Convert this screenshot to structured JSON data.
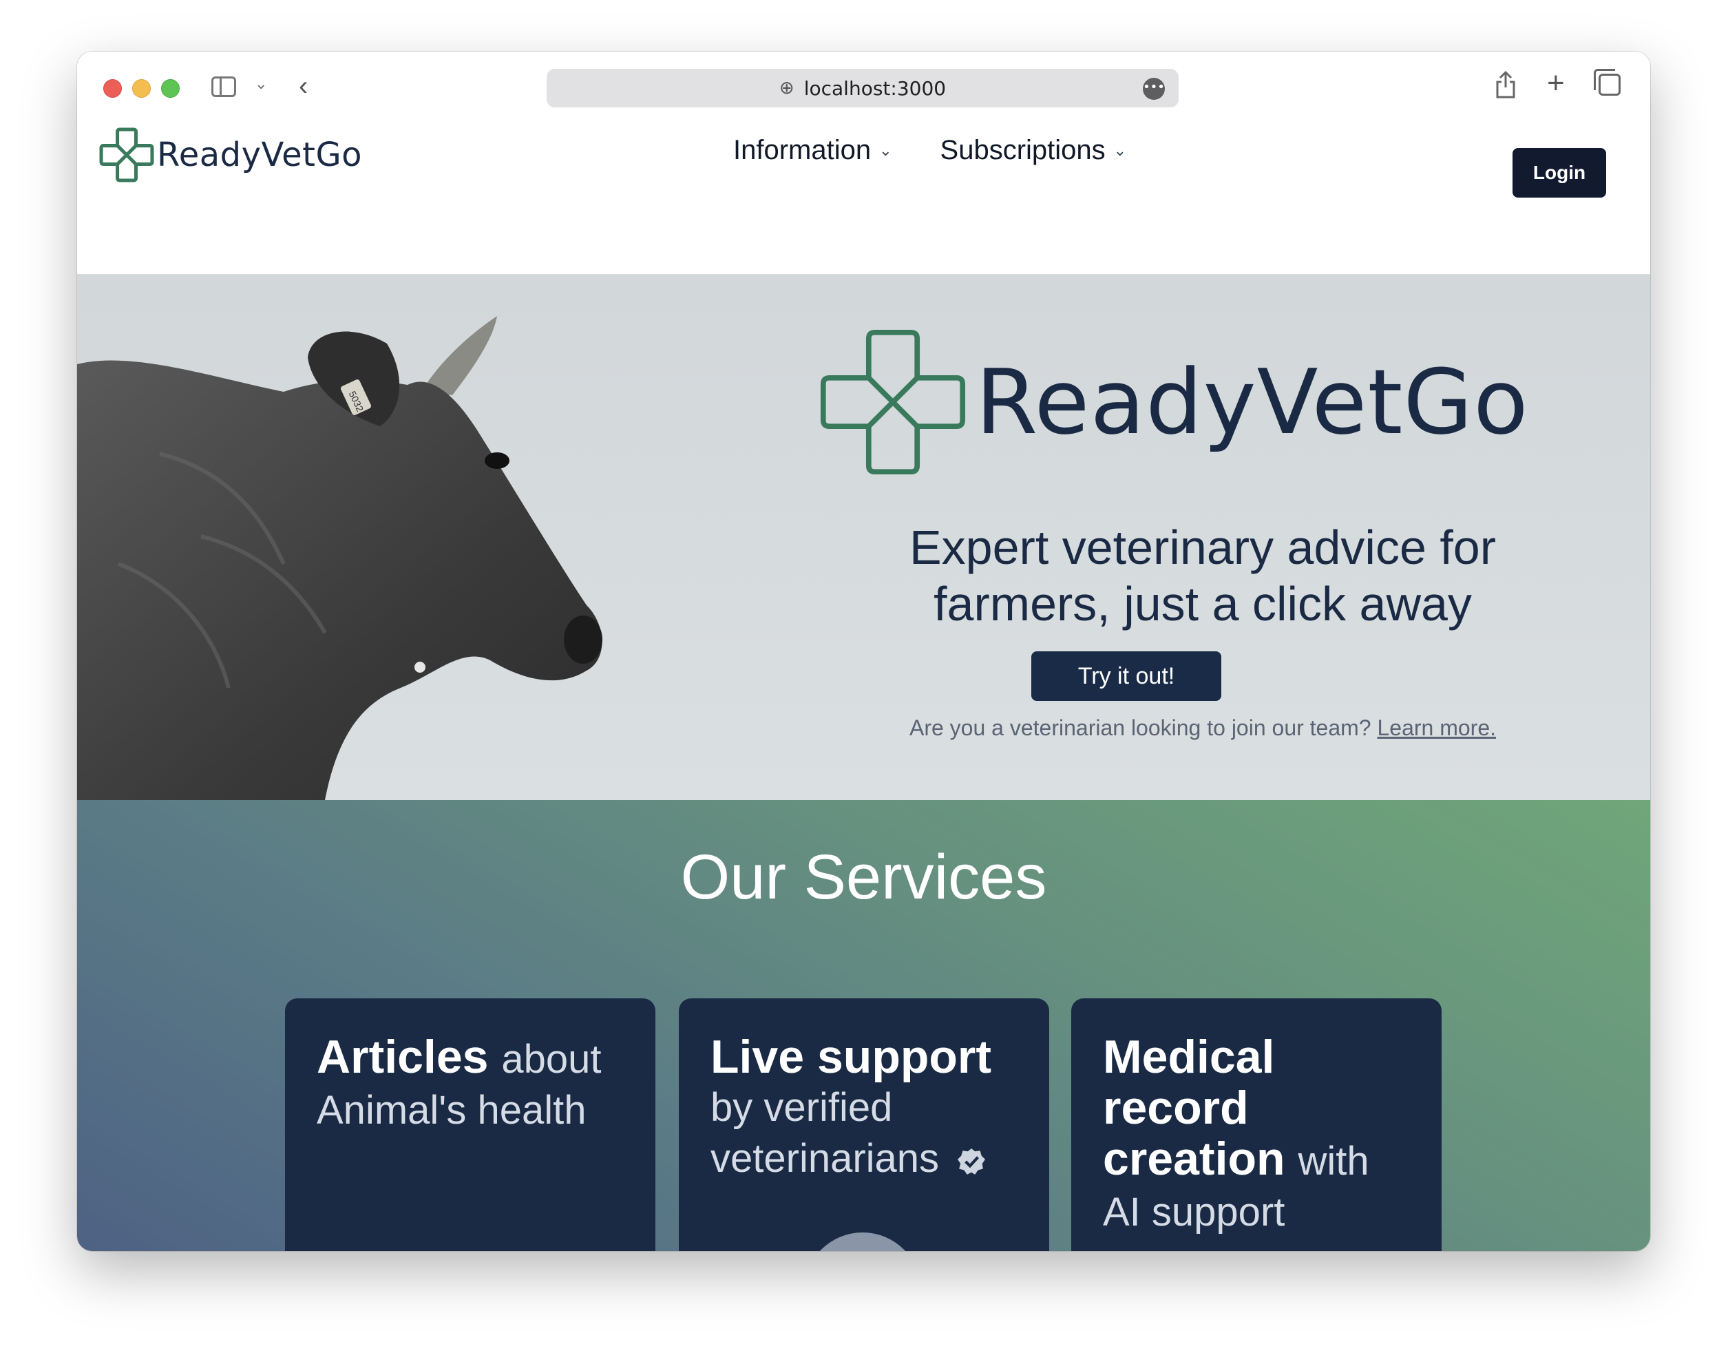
{
  "browser": {
    "url": "localhost:3000"
  },
  "nav": {
    "brand": "ReadyVetGo",
    "menu": [
      {
        "label": "Information"
      },
      {
        "label": "Subscriptions"
      }
    ],
    "login_label": "Login"
  },
  "hero": {
    "brand": "ReadyVetGo",
    "tagline_line1": "Expert veterinary advice for",
    "tagline_line2": "farmers, just a click away",
    "cta_label": "Try it out!",
    "vet_prompt": "Are you a veterinarian looking to join our team?",
    "vet_link": "Learn more.",
    "ear_tag": "5032"
  },
  "services": {
    "title": "Our Services",
    "cards": [
      {
        "bold": "Articles",
        "rest1": "about",
        "rest2": "Animal's health"
      },
      {
        "bold": "Live support",
        "rest1": "by verified",
        "rest2": "veterinarians"
      },
      {
        "bold1": "Medical",
        "bold2": "record",
        "bold3": "creation",
        "rest1": "with",
        "rest2": "AI support"
      }
    ]
  },
  "colors": {
    "brand_navy": "#1b2a44",
    "brand_green": "#3a7a5c",
    "card_bg": "#1a2a45",
    "button_bg": "#111a2e"
  },
  "icons": {
    "sidebar": "sidebar-icon",
    "back": "chevron-left-icon",
    "share": "share-icon",
    "new_tab": "plus-icon",
    "tabs": "tabs-overview-icon",
    "verified": "verified-badge-icon"
  }
}
